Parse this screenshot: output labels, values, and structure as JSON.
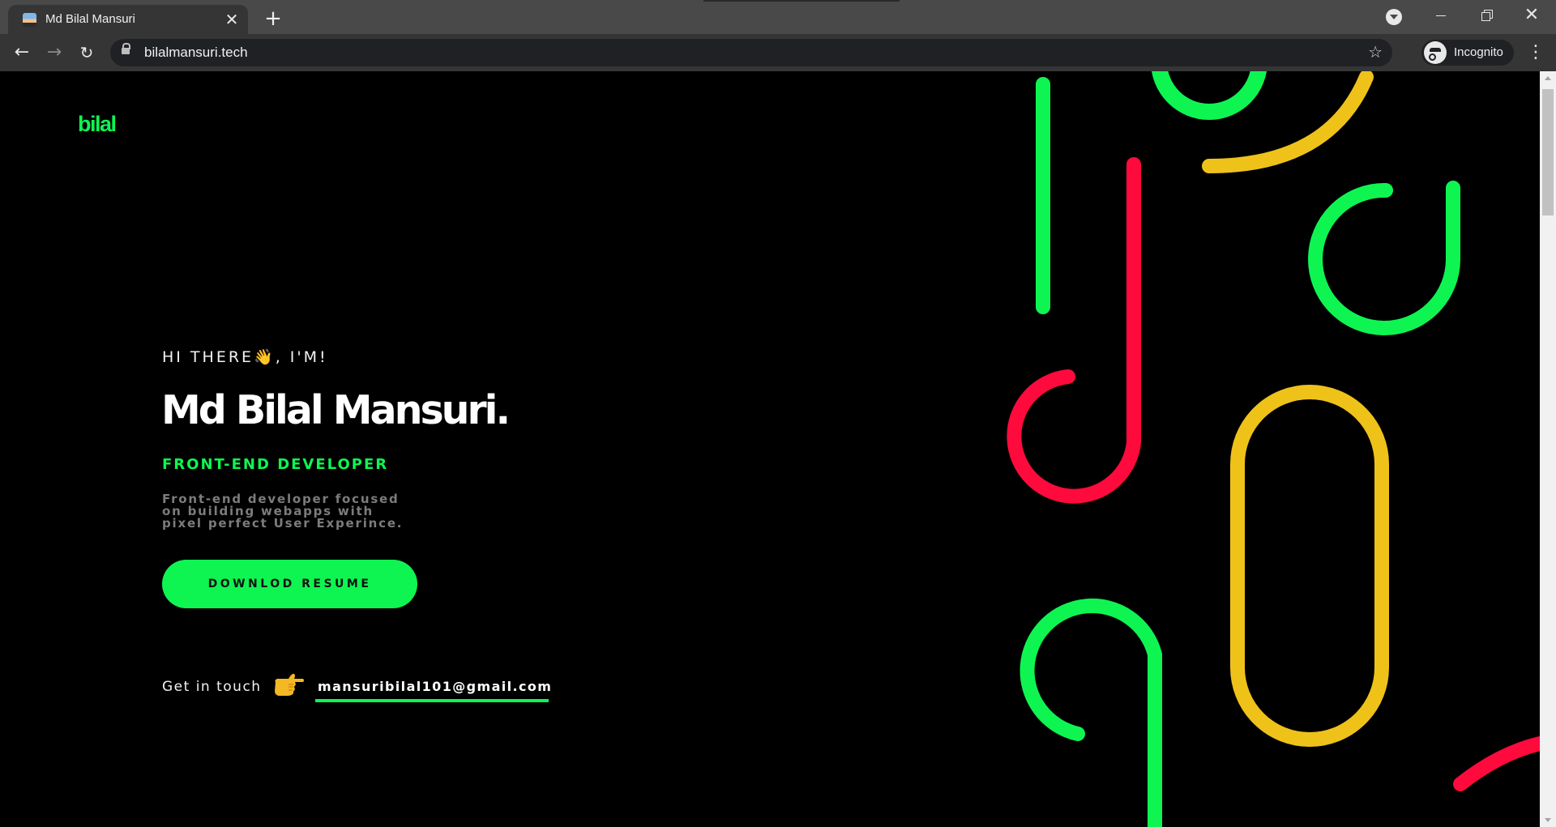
{
  "browser": {
    "tab": {
      "title": "Md Bilal Mansuri",
      "close_glyph": "✕",
      "favicon": "avatar-favicon"
    },
    "new_tab_glyph": "+",
    "window_controls": {
      "close_glyph": "✕"
    },
    "nav": {
      "back_glyph": "←",
      "forward_glyph": "→",
      "reload_glyph": "↻"
    },
    "address_bar": {
      "url": "bilalmansuri.tech",
      "star_glyph": "☆"
    },
    "profile": {
      "label": "Incognito"
    },
    "menu_glyph": "⋮"
  },
  "page": {
    "logo": "bilal",
    "greeting": "HI THERE👋, I'M!",
    "name": "Md Bilal Mansuri.",
    "role": "FRONT-END DEVELOPER",
    "description_lines": [
      "Front-end developer focused",
      "on building webapps with",
      "pixel perfect User Experince."
    ],
    "resume_button": "DOWNLOD RESUME",
    "contact": {
      "label": "Get in touch",
      "email": "mansuribilal101@gmail.com",
      "icon": "pointing-hand-icon"
    }
  },
  "colors": {
    "background": "#000000",
    "accent_green": "#0ef551",
    "accent_red": "#ff0a3c",
    "accent_yellow": "#efc21a",
    "chrome_dark": "#353535",
    "chrome_tabstrip": "#494949"
  }
}
